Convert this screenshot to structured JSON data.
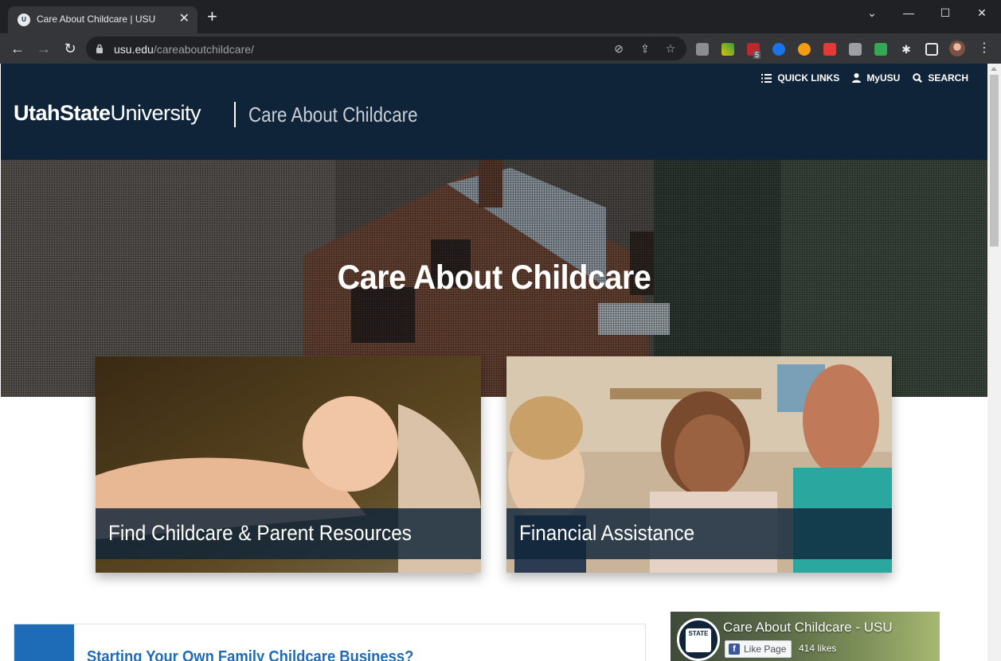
{
  "browser": {
    "tab_title": "Care About Childcare | USU",
    "url_domain": "usu.edu",
    "url_path": "/careaboutchildcare/",
    "extension_badge": "5"
  },
  "header": {
    "quick_links": "QUICK LINKS",
    "myusu": "MyUSU",
    "search": "SEARCH",
    "logo_bold": "UtahState",
    "logo_regular": "University",
    "site_title": "Care About Childcare"
  },
  "hero": {
    "title": "Care About Childcare"
  },
  "cards": [
    {
      "label": "Find Childcare & Parent Resources"
    },
    {
      "label": "Financial Assistance"
    }
  ],
  "news": {
    "title": "Starting Your Own Family Childcare Business?"
  },
  "facebook": {
    "page_name": "Care About Childcare - USU",
    "like_button": "Like Page",
    "likes": "414 likes",
    "logo_text": "STATE"
  },
  "colors": {
    "header_bg": "#0f2439",
    "accent_blue": "#1e6bb8"
  }
}
